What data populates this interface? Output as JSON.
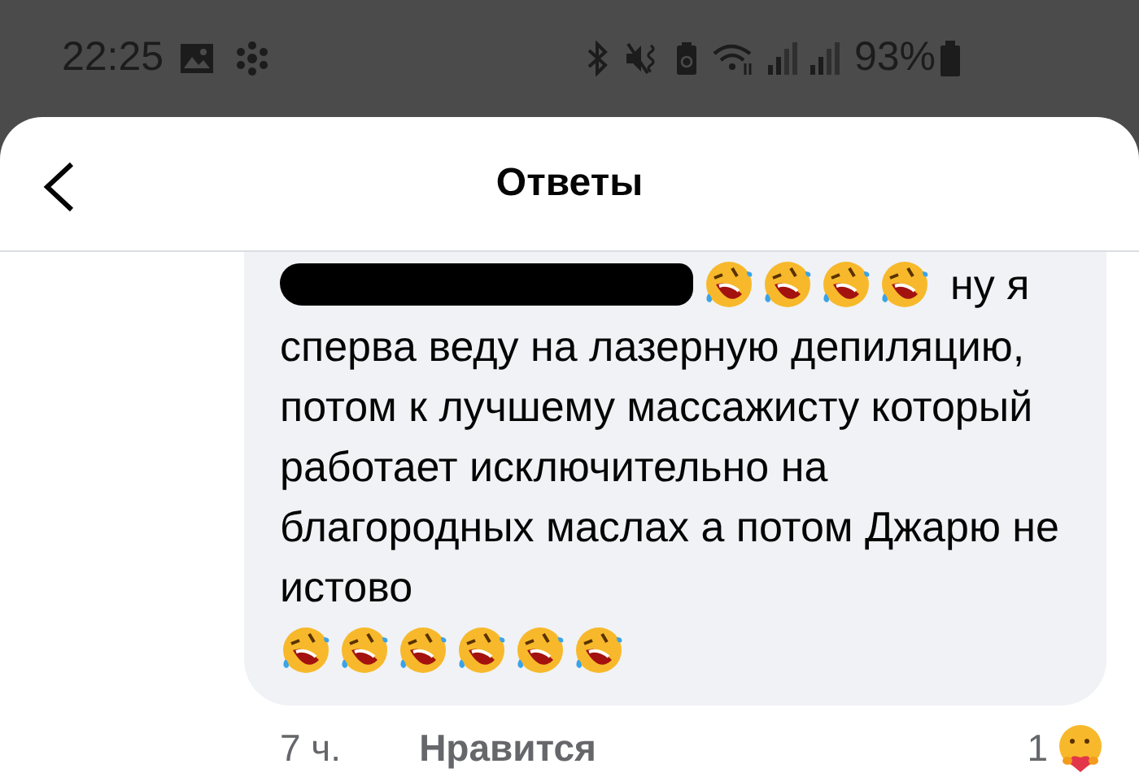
{
  "status_bar": {
    "time": "22:25",
    "battery": "93%"
  },
  "header": {
    "title": "Ответы"
  },
  "comment": {
    "first_line": [
      {
        "kind": "redaction"
      },
      {
        "kind": "emoji"
      },
      {
        "kind": "emoji"
      },
      {
        "kind": "emoji"
      },
      {
        "kind": "emoji"
      },
      {
        "kind": "text",
        "text": "ну я"
      }
    ],
    "body": "сперва веду на лазерную депиляцию, потом к лучшему массажисту который работает исключительно на благородных маслах а потом Джарю не истово",
    "last_line": [
      {
        "kind": "emoji"
      },
      {
        "kind": "emoji"
      },
      {
        "kind": "emoji"
      },
      {
        "kind": "emoji"
      },
      {
        "kind": "emoji"
      },
      {
        "kind": "emoji"
      }
    ],
    "time": "7 ч.",
    "like": "Нравится",
    "reaction_count": "1"
  }
}
